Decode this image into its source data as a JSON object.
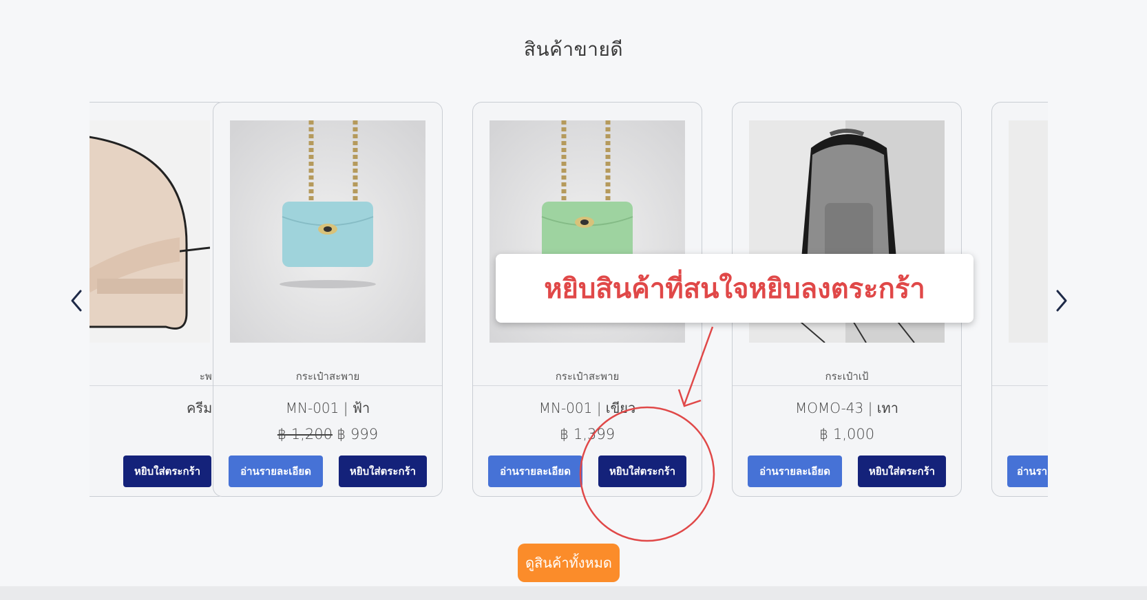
{
  "section": {
    "title": "สินค้าขายดี",
    "view_all_label": "ดูสินค้าทั้งหมด"
  },
  "carousel": {
    "prev_icon": "chevron-left-icon",
    "next_icon": "chevron-right-icon"
  },
  "products": [
    {
      "category": "ะพาย",
      "name": "ครีม",
      "old_price": "",
      "price": "",
      "detail_label": "",
      "cart_label": "หยิบใส่ตระกร้า",
      "image": "cream-bag-image"
    },
    {
      "category": "กระเป๋าสะพาย",
      "name": "MN-001 | ฟ้า",
      "old_price": "฿ 1,200",
      "price": "฿ 999",
      "detail_label": "อ่านรายละเอียด",
      "cart_label": "หยิบใส่ตระกร้า",
      "image": "blue-bag-image"
    },
    {
      "category": "กระเป๋าสะพาย",
      "name": "MN-001 | เขียว",
      "old_price": "",
      "price": "฿ 1,399",
      "detail_label": "อ่านรายละเอียด",
      "cart_label": "หยิบใส่ตระกร้า",
      "image": "green-bag-image"
    },
    {
      "category": "กระเป๋าเป้",
      "name": "MOMO-43 | เทา",
      "old_price": "",
      "price": "฿ 1,000",
      "detail_label": "อ่านรายละเอียด",
      "cart_label": "หยิบใส่ตระกร้า",
      "image": "gray-backpack-image"
    },
    {
      "category": "",
      "name": "",
      "old_price": "",
      "price": "",
      "detail_label": "อ่านรา",
      "cart_label": "",
      "image": "product-image"
    }
  ],
  "annotation": {
    "callout_text": "หยิบสินค้าที่สนใจหยิบลงตระกร้า",
    "color": "#e04848"
  },
  "colors": {
    "detail_button": "#4672d6",
    "cart_button": "#14227a",
    "view_all_button": "#fb8c2a"
  }
}
